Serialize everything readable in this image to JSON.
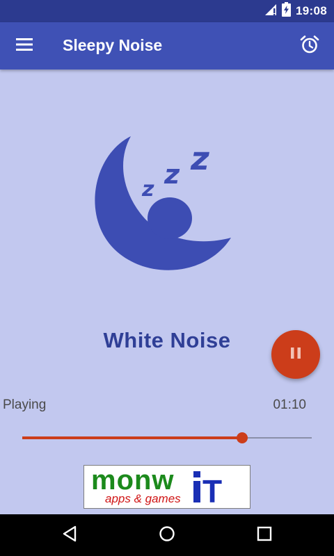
{
  "status_bar": {
    "time": "19:08",
    "icons": [
      "signal-icon",
      "battery-charging-icon"
    ]
  },
  "app_bar": {
    "title": "Sleepy Noise",
    "menu_icon": "menu-icon",
    "alarm_icon": "alarm-clock-icon"
  },
  "player": {
    "sound_name": "White Noise",
    "status": "Playing",
    "time": "01:10",
    "progress_fraction": 0.76,
    "fab_icon": "pause-icon"
  },
  "ad_banner": {
    "logo_text": "monwiT",
    "tagline": "apps & games"
  },
  "nav_bar": {
    "icons": [
      "back-icon",
      "home-icon",
      "recents-icon"
    ]
  },
  "colors": {
    "background": "#c2c8ef",
    "status_bar": "#2c3a8f",
    "app_bar": "#3f51b5",
    "moon": "#3d4db3",
    "accent": "#cc3d1a",
    "title_text": "#2f3f96",
    "ad_green": "#1c8a1c",
    "ad_red": "#d01515",
    "ad_blue": "#1a2fb5"
  }
}
